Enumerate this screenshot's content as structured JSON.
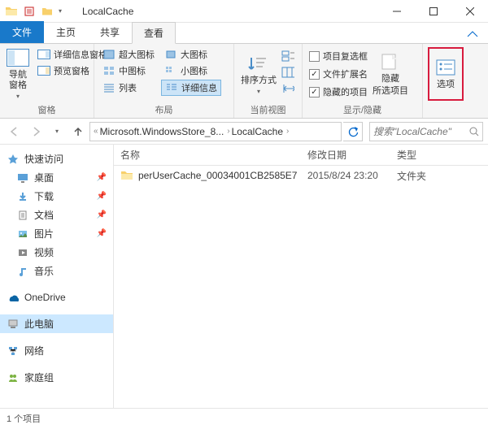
{
  "window": {
    "title": "LocalCache"
  },
  "tabs": {
    "file": "文件",
    "home": "主页",
    "share": "共享",
    "view": "查看"
  },
  "ribbon": {
    "panes": {
      "nav_pane": "导航窗格",
      "detail_pane": "详细信息窗格",
      "preview_pane": "预览窗格",
      "group_label": "窗格"
    },
    "layout": {
      "extra_large": "超大图标",
      "large": "大图标",
      "medium": "中图标",
      "small": "小图标",
      "list": "列表",
      "details": "详细信息",
      "group_label": "布局"
    },
    "current_view": {
      "sort": "排序方式",
      "group_label": "当前视图"
    },
    "show_hide": {
      "item_checkboxes": "项目复选框",
      "file_ext": "文件扩展名",
      "hidden_items": "隐藏的项目",
      "hide": "隐藏",
      "selected": "所选项目",
      "group_label": "显示/隐藏",
      "checks": {
        "item_checkboxes": false,
        "file_ext": true,
        "hidden_items": true
      }
    },
    "options": "选项"
  },
  "breadcrumb": {
    "seg1": "Microsoft.WindowsStore_8...",
    "seg2": "LocalCache"
  },
  "search": {
    "placeholder": "搜索\"LocalCache\""
  },
  "sidebar": {
    "quick_access": "快速访问",
    "desktop": "桌面",
    "downloads": "下载",
    "documents": "文档",
    "pictures": "图片",
    "videos": "视频",
    "music": "音乐",
    "onedrive": "OneDrive",
    "this_pc": "此电脑",
    "network": "网络",
    "homegroup": "家庭组"
  },
  "columns": {
    "name": "名称",
    "date": "修改日期",
    "type": "类型"
  },
  "rows": [
    {
      "name": "perUserCache_00034001CB2585E7",
      "date": "2015/8/24 23:20",
      "type": "文件夹"
    }
  ],
  "status": {
    "count": "1 个项目"
  }
}
